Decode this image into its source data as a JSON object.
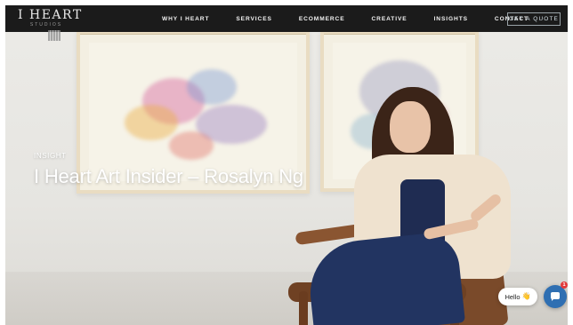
{
  "header": {
    "logo_text": "I HEART",
    "logo_subtext": "STUDIOS",
    "nav": [
      {
        "label": "WHY I HEART"
      },
      {
        "label": "SERVICES"
      },
      {
        "label": "ECOMMERCE"
      },
      {
        "label": "CREATIVE"
      },
      {
        "label": "INSIGHTS"
      },
      {
        "label": "CONTACT"
      }
    ],
    "cta_label": "GET A QUOTE"
  },
  "hero": {
    "kicker": "INSIGHT",
    "title": "I Heart Art Insider – Rosalyn Ng"
  },
  "chat": {
    "greeting": "Hello",
    "wave_emoji": "👋",
    "badge_count": "1"
  },
  "colors": {
    "nav_bg": "#1b1b1b",
    "chat_accent": "#2f6fb2",
    "badge": "#e23b3b"
  }
}
